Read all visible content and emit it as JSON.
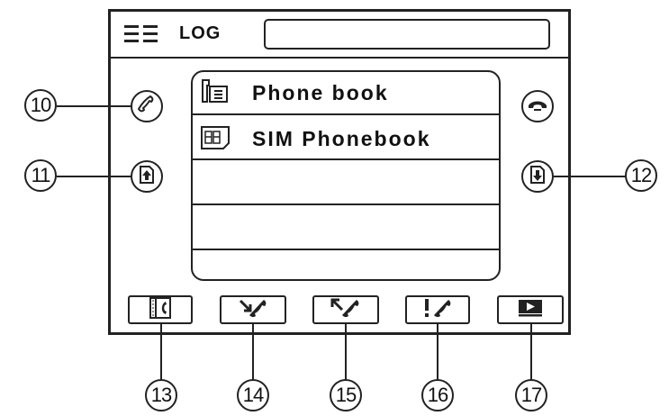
{
  "header": {
    "title": "LOG",
    "menu_icon": "menu-icon",
    "title_field_value": ""
  },
  "list": {
    "items": [
      {
        "label": "Phone book",
        "icon": "phonebook-icon"
      },
      {
        "label": "SIM Phonebook",
        "icon": "sim-card-icon"
      },
      {
        "label": ""
      },
      {
        "label": ""
      },
      {
        "label": ""
      }
    ]
  },
  "side_buttons": {
    "left": [
      {
        "icon": "call-icon",
        "callout": "10"
      },
      {
        "icon": "page-up-icon",
        "callout": "11"
      }
    ],
    "right": [
      {
        "icon": "hang-up-icon"
      },
      {
        "icon": "page-down-icon",
        "callout": "12"
      }
    ]
  },
  "bottom_buttons": [
    {
      "icon": "call-log-icon",
      "callout": "13"
    },
    {
      "icon": "received-call-icon",
      "callout": "14"
    },
    {
      "icon": "dialed-call-icon",
      "callout": "15"
    },
    {
      "icon": "missed-call-icon",
      "callout": "16"
    },
    {
      "icon": "media-play-icon",
      "callout": "17"
    }
  ]
}
